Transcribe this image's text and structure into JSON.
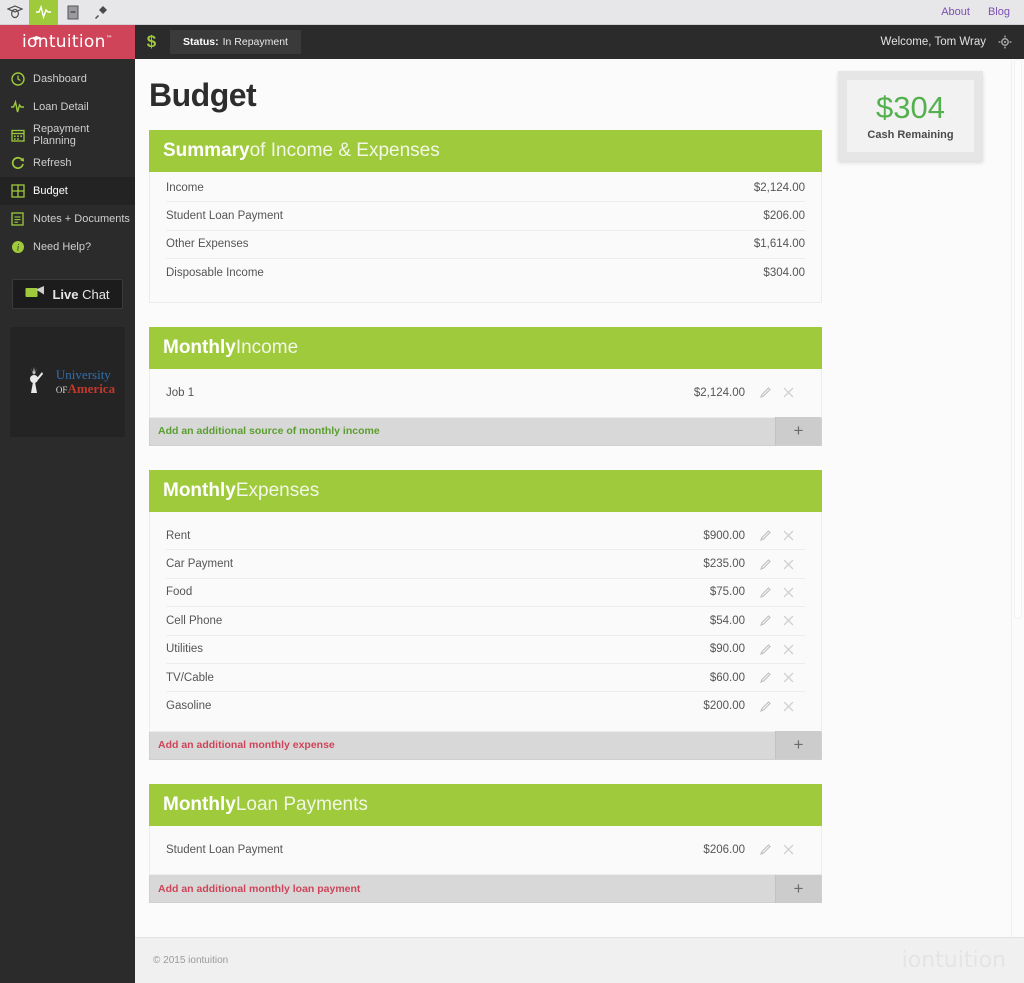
{
  "browser": {
    "bookmarks": [
      {
        "icon": "graduation-cap-icon",
        "active": false
      },
      {
        "icon": "activity-pulse-icon",
        "active": true
      },
      {
        "icon": "book-icon",
        "active": false
      },
      {
        "icon": "plug-icon",
        "active": false
      }
    ],
    "links": [
      {
        "label": "About"
      },
      {
        "label": "Blog"
      }
    ]
  },
  "header": {
    "brand": "iontuition",
    "brand_tm": "™",
    "dollar_icon": "$",
    "status_label": "Status:",
    "status_value": "In Repayment",
    "welcome": "Welcome, Tom Wray",
    "gear_icon": "gear-icon"
  },
  "sidebar": {
    "items": [
      {
        "label": "Dashboard",
        "icon": "dashboard-clock-icon",
        "active": false
      },
      {
        "label": "Loan Detail",
        "icon": "activity-pulse-icon",
        "active": false
      },
      {
        "label": "Repayment Planning",
        "icon": "calendar-icon",
        "active": false
      },
      {
        "label": "Refresh",
        "icon": "refresh-icon",
        "active": false
      },
      {
        "label": "Budget",
        "icon": "grid-icon",
        "active": true
      },
      {
        "label": "Notes + Documents",
        "icon": "notes-icon",
        "active": false
      },
      {
        "label": "Need Help?",
        "icon": "info-icon",
        "active": false
      }
    ],
    "live_chat": {
      "bold": "Live",
      "normal": " Chat",
      "icon": "chat-bubble-icon"
    },
    "university": {
      "line1": "University",
      "of": "OF",
      "name": "America",
      "icon": "liberty-statue-icon"
    }
  },
  "main": {
    "page_title": "Budget",
    "cash_widget": {
      "amount": "$304",
      "label": "Cash Remaining"
    },
    "summary": {
      "title_bold": "Summary",
      "title_light": " of Income & Expenses",
      "rows": [
        {
          "label": "Income",
          "amount": "$2,124.00"
        },
        {
          "label": "Student Loan Payment",
          "amount": "$206.00"
        },
        {
          "label": "Other Expenses",
          "amount": "$1,614.00"
        },
        {
          "label": "Disposable Income",
          "amount": "$304.00"
        }
      ]
    },
    "income": {
      "title_bold": "Monthly",
      "title_light": " Income",
      "rows": [
        {
          "label": "Job 1",
          "amount": "$2,124.00"
        }
      ],
      "add_label": "Add an additional source of monthly income",
      "add_plus": "+"
    },
    "expenses": {
      "title_bold": "Monthly",
      "title_light": " Expenses",
      "rows": [
        {
          "label": "Rent",
          "amount": "$900.00"
        },
        {
          "label": "Car Payment",
          "amount": "$235.00"
        },
        {
          "label": "Food",
          "amount": "$75.00"
        },
        {
          "label": "Cell Phone",
          "amount": "$54.00"
        },
        {
          "label": "Utilities",
          "amount": "$90.00"
        },
        {
          "label": "TV/Cable",
          "amount": "$60.00"
        },
        {
          "label": "Gasoline",
          "amount": "$200.00"
        }
      ],
      "add_label": "Add an additional monthly expense",
      "add_plus": "+"
    },
    "loans": {
      "title_bold": "Monthly",
      "title_light": " Loan Payments",
      "rows": [
        {
          "label": "Student Loan Payment",
          "amount": "$206.00"
        }
      ],
      "add_label": "Add an additional monthly loan payment",
      "add_plus": "+"
    }
  },
  "footer": {
    "copyright": "© 2015 iontuition",
    "watermark": "iontuition"
  },
  "colors": {
    "brand_red": "#cf4458",
    "accent_green": "#9fca3c",
    "cash_green": "#55b04f",
    "dark": "#2b2b2b",
    "link_purple": "#7d4fb0"
  }
}
